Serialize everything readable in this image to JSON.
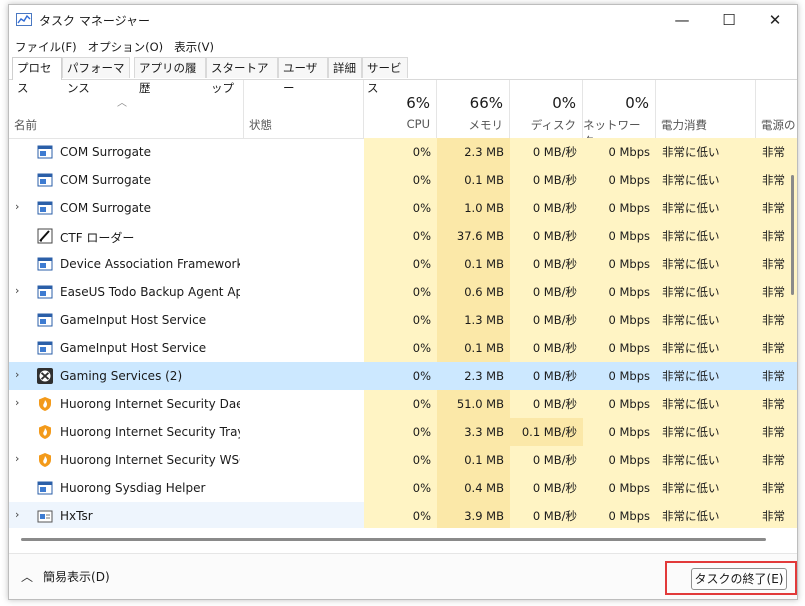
{
  "window": {
    "title": "タスク マネージャー",
    "controls": {
      "minimize": "—",
      "maximize": "☐",
      "close": "✕"
    }
  },
  "menu": [
    "ファイル(F)",
    "オプション(O)",
    "表示(V)"
  ],
  "tabs": [
    {
      "label": "プロセス",
      "active": true
    },
    {
      "label": "パフォーマンス"
    },
    {
      "label": "アプリの履歴"
    },
    {
      "label": "スタートアップ"
    },
    {
      "label": "ユーザー"
    },
    {
      "label": "詳細"
    },
    {
      "label": "サービス"
    }
  ],
  "columns": {
    "name": "名前",
    "status": "状態",
    "cpu": {
      "pct": "6%",
      "label": "CPU"
    },
    "memory": {
      "pct": "66%",
      "label": "メモリ"
    },
    "disk": {
      "pct": "0%",
      "label": "ディスク"
    },
    "network": {
      "pct": "0%",
      "label": "ネットワーク"
    },
    "power": "電力消費",
    "power_trend": "電源の"
  },
  "rows": [
    {
      "name": "COM Surrogate",
      "icon": "service-window-icon",
      "expandable": false,
      "cpu": "0%",
      "mem": "2.3 MB",
      "disk": "0 MB/秒",
      "net": "0 Mbps",
      "power": "非常に低い",
      "trend": "非常"
    },
    {
      "name": "COM Surrogate",
      "icon": "service-window-icon",
      "expandable": false,
      "cpu": "0%",
      "mem": "0.1 MB",
      "disk": "0 MB/秒",
      "net": "0 Mbps",
      "power": "非常に低い",
      "trend": "非常"
    },
    {
      "name": "COM Surrogate",
      "icon": "service-window-icon",
      "expandable": true,
      "cpu": "0%",
      "mem": "1.0 MB",
      "disk": "0 MB/秒",
      "net": "0 Mbps",
      "power": "非常に低い",
      "trend": "非常"
    },
    {
      "name": "CTF ローダー",
      "icon": "ctf-pen-icon",
      "expandable": false,
      "cpu": "0%",
      "mem": "37.6 MB",
      "disk": "0 MB/秒",
      "net": "0 Mbps",
      "power": "非常に低い",
      "trend": "非常"
    },
    {
      "name": "Device Association Framework ...",
      "icon": "service-window-icon",
      "expandable": false,
      "cpu": "0%",
      "mem": "0.1 MB",
      "disk": "0 MB/秒",
      "net": "0 Mbps",
      "power": "非常に低い",
      "trend": "非常"
    },
    {
      "name": "EaseUS Todo Backup Agent App...",
      "icon": "service-window-icon",
      "expandable": true,
      "cpu": "0%",
      "mem": "0.6 MB",
      "disk": "0 MB/秒",
      "net": "0 Mbps",
      "power": "非常に低い",
      "trend": "非常"
    },
    {
      "name": "GameInput Host Service",
      "icon": "service-window-icon",
      "expandable": false,
      "cpu": "0%",
      "mem": "1.3 MB",
      "disk": "0 MB/秒",
      "net": "0 Mbps",
      "power": "非常に低い",
      "trend": "非常"
    },
    {
      "name": "GameInput Host Service",
      "icon": "service-window-icon",
      "expandable": false,
      "cpu": "0%",
      "mem": "0.1 MB",
      "disk": "0 MB/秒",
      "net": "0 Mbps",
      "power": "非常に低い",
      "trend": "非常"
    },
    {
      "name": "Gaming Services (2)",
      "icon": "xbox-icon",
      "expandable": true,
      "selected": true,
      "cpu": "0%",
      "mem": "2.3 MB",
      "disk": "0 MB/秒",
      "net": "0 Mbps",
      "power": "非常に低い",
      "trend": "非常"
    },
    {
      "name": "Huorong Internet Security Dae...",
      "icon": "huorong-shield-icon",
      "expandable": true,
      "cpu": "0%",
      "mem": "51.0 MB",
      "disk": "0 MB/秒",
      "net": "0 Mbps",
      "power": "非常に低い",
      "trend": "非常"
    },
    {
      "name": "Huorong Internet Security Tray (...",
      "icon": "huorong-shield-icon",
      "expandable": false,
      "cpu": "0%",
      "mem": "3.3 MB",
      "disk": "0.1 MB/秒",
      "net": "0 Mbps",
      "power": "非常に低い",
      "trend": "非常",
      "disk_hot": true
    },
    {
      "name": "Huorong Internet Security WSC ...",
      "icon": "huorong-shield-icon",
      "expandable": true,
      "cpu": "0%",
      "mem": "0.1 MB",
      "disk": "0 MB/秒",
      "net": "0 Mbps",
      "power": "非常に低い",
      "trend": "非常"
    },
    {
      "name": "Huorong Sysdiag Helper",
      "icon": "service-window-icon",
      "expandable": false,
      "cpu": "0%",
      "mem": "0.4 MB",
      "disk": "0 MB/秒",
      "net": "0 Mbps",
      "power": "非常に低い",
      "trend": "非常"
    },
    {
      "name": "HxTsr",
      "icon": "hxtsr-window-icon",
      "expandable": true,
      "hover": true,
      "cpu": "0%",
      "mem": "3.9 MB",
      "disk": "0 MB/秒",
      "net": "0 Mbps",
      "power": "非常に低い",
      "trend": "非常"
    }
  ],
  "footer": {
    "fewer_details": "簡易表示(D)",
    "end_task": "タスクの終了(E)"
  },
  "colors": {
    "selected_row": "#cce8ff",
    "heat_low": "#fff4c4",
    "heat_mid": "#fbe8a8",
    "highlight_border": "#e23a3a"
  }
}
